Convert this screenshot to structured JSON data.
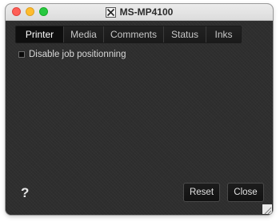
{
  "window": {
    "title": "MS-MP4100",
    "icon": "x-window-icon"
  },
  "tabs": [
    {
      "label": "Printer",
      "active": true
    },
    {
      "label": "Media",
      "active": false
    },
    {
      "label": "Comments",
      "active": false
    },
    {
      "label": "Status",
      "active": false
    },
    {
      "label": "Inks",
      "active": false
    }
  ],
  "options": {
    "disable_job_positioning": {
      "label": "Disable job positionning",
      "checked": false
    }
  },
  "footer": {
    "help_label": "?",
    "reset_label": "Reset",
    "close_label": "Close"
  }
}
